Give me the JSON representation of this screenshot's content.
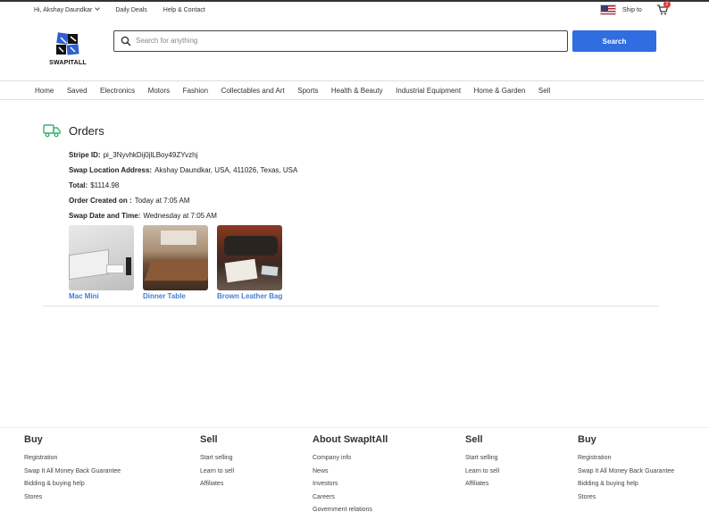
{
  "topbar": {
    "greeting": "Hi, Akshay Daundkar",
    "daily_deals": "Daily Deals",
    "help": "Help & Contact",
    "ship_to": "Ship to",
    "cart_count": "2"
  },
  "header": {
    "logo_text": "SWAPITALL",
    "search_placeholder": "Search for anything",
    "search_button": "Search"
  },
  "nav": {
    "items": [
      "Home",
      "Saved",
      "Electronics",
      "Motors",
      "Fashion",
      "Collectables and Art",
      "Sports",
      "Health & Beauty",
      "Industrial Equipment",
      "Home & Garden",
      "Sell"
    ]
  },
  "orders": {
    "title": "Orders",
    "stripe_label": "Stripe ID:",
    "stripe_value": "pi_3NyvhkDij0jlLBoy49ZYvzhj",
    "address_label": "Swap Location Address:",
    "address_value": "Akshay Daundkar, USA, 411026, Texas, USA",
    "total_label": "Total:",
    "total_value": "$1114.98",
    "created_label": "Order Created on :",
    "created_value": "Today at 7:05 AM",
    "swap_label": "Swap Date and Time:",
    "swap_value": "Wednesday at 7:05 AM",
    "products": [
      {
        "name": "Mac Mini"
      },
      {
        "name": "Dinner Table"
      },
      {
        "name": "Brown Leather Bag"
      }
    ]
  },
  "footer": {
    "columns": [
      {
        "title": "Buy",
        "links": [
          "Registration",
          "Swap It All Money Back Guarantee",
          "Bidding & buying help",
          "Stores"
        ]
      },
      {
        "title": "Sell",
        "links": [
          "Start selling",
          "Learn to sell",
          "Affiliates"
        ]
      },
      {
        "title": "About SwapItAll",
        "links": [
          "Company info",
          "News",
          "Investors",
          "Careers",
          "Government relations"
        ]
      },
      {
        "title": "Sell",
        "links": [
          "Start selling",
          "Learn to sell",
          "Affiliates"
        ]
      },
      {
        "title": "Buy",
        "links": [
          "Registration",
          "Swap It All Money Back Guarantee",
          "Bidding & buying help",
          "Stores"
        ]
      }
    ]
  },
  "colors": {
    "accent": "#2f6de1",
    "link": "#3f7ed8",
    "truck_icon": "#3cb371"
  },
  "icons": [
    "search-icon",
    "cart-icon",
    "truck-icon",
    "us-flag-icon",
    "chevron-down-icon"
  ]
}
